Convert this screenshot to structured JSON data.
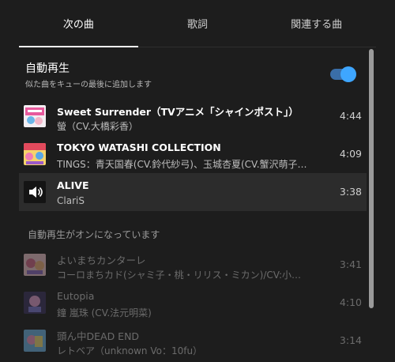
{
  "tabs": [
    {
      "label": "次の曲",
      "active": true
    },
    {
      "label": "歌詞",
      "active": false
    },
    {
      "label": "関連する曲",
      "active": false
    }
  ],
  "autoplay": {
    "title": "自動再生",
    "subtitle": "似た曲をキューの最後に追加します",
    "enabled": true
  },
  "queue": [
    {
      "title": "Sweet Surrender（TVアニメ「シャインポスト」）",
      "artist": "螢（CV.大橋彩香）",
      "duration": "4:44"
    },
    {
      "title": "TOKYO WATASHI COLLECTION",
      "artist": "TINGS：青天国春(CV.鈴代紗弓)、玉城杏夏(CV.蟹沢萌子…",
      "duration": "4:09"
    },
    {
      "title": "ALIVE",
      "artist": "ClariS",
      "duration": "3:38",
      "playing": true
    }
  ],
  "autoplay_section_label": "自動再生がオンになっています",
  "autoplay_queue": [
    {
      "title": "よいまちカンターレ",
      "artist": "コーロまちカド(シャミ子・桃・リリス・ミカン)/CV:小…",
      "duration": "3:41"
    },
    {
      "title": "Eutopia",
      "artist": "鐘 嵐珠 (CV.法元明菜)",
      "duration": "4:10"
    },
    {
      "title": "頭ん中DEAD END",
      "artist": "レトベア（unknown Vo：10fu）",
      "duration": "3:14"
    }
  ],
  "colors": {
    "accent": "#3ea6ff",
    "background": "#1d1d1d",
    "playing_row": "#2c2c2c"
  }
}
